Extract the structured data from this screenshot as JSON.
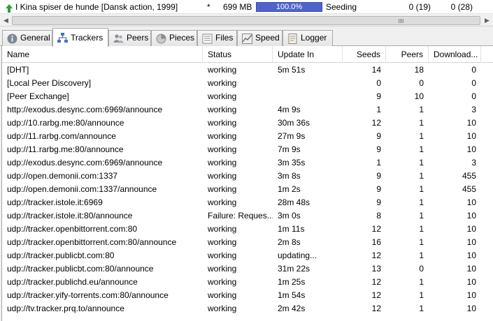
{
  "torrent": {
    "name": "I Kina spiser de hunde [Dansk action, 1999]",
    "star": "*",
    "size": "699 MB",
    "progress_label": "100.0%",
    "progress": 1.0,
    "status": "Seeding",
    "seeds": "0 (19)",
    "peers": "0 (28)"
  },
  "scrollbar": {
    "left_icon": "arrow-left-icon",
    "right_icon": "arrow-right-icon"
  },
  "tabs": [
    {
      "label": "General",
      "icon": "info-icon"
    },
    {
      "label": "Trackers",
      "icon": "network-icon",
      "active": true
    },
    {
      "label": "Peers",
      "icon": "people-icon"
    },
    {
      "label": "Pieces",
      "icon": "pie-icon"
    },
    {
      "label": "Files",
      "icon": "file-list-icon"
    },
    {
      "label": "Speed",
      "icon": "graph-icon"
    },
    {
      "label": "Logger",
      "icon": "log-icon"
    }
  ],
  "columns": {
    "name": "Name",
    "status": "Status",
    "update_in": "Update In",
    "seeds": "Seeds",
    "peers": "Peers",
    "downloaded": "Download..."
  },
  "rows": [
    {
      "name": "[DHT]",
      "status": "working",
      "update": "5m 51s",
      "seeds": "14",
      "peers": "18",
      "downloaded": "0"
    },
    {
      "name": "[Local Peer Discovery]",
      "status": "working",
      "update": "",
      "seeds": "0",
      "peers": "0",
      "downloaded": "0"
    },
    {
      "name": "[Peer Exchange]",
      "status": "working",
      "update": "",
      "seeds": "9",
      "peers": "10",
      "downloaded": "0"
    },
    {
      "name": "http://exodus.desync.com:6969/announce",
      "status": "working",
      "update": "4m 9s",
      "seeds": "1",
      "peers": "1",
      "downloaded": "3"
    },
    {
      "name": "udp://10.rarbg.me:80/announce",
      "status": "working",
      "update": "30m 36s",
      "seeds": "12",
      "peers": "1",
      "downloaded": "10"
    },
    {
      "name": "udp://11.rarbg.com/announce",
      "status": "working",
      "update": "27m 9s",
      "seeds": "9",
      "peers": "1",
      "downloaded": "10"
    },
    {
      "name": "udp://11.rarbg.me:80/announce",
      "status": "working",
      "update": "7m 9s",
      "seeds": "9",
      "peers": "1",
      "downloaded": "10"
    },
    {
      "name": "udp://exodus.desync.com:6969/announce",
      "status": "working",
      "update": "3m 35s",
      "seeds": "1",
      "peers": "1",
      "downloaded": "3"
    },
    {
      "name": "udp://open.demonii.com:1337",
      "status": "working",
      "update": "3m 8s",
      "seeds": "9",
      "peers": "1",
      "downloaded": "455"
    },
    {
      "name": "udp://open.demonii.com:1337/announce",
      "status": "working",
      "update": "1m 2s",
      "seeds": "9",
      "peers": "1",
      "downloaded": "455"
    },
    {
      "name": "udp://tracker.istole.it:6969",
      "status": "working",
      "update": "28m 48s",
      "seeds": "9",
      "peers": "1",
      "downloaded": "10"
    },
    {
      "name": "udp://tracker.istole.it:80/announce",
      "status": "Failure: Reques...",
      "update": "3m 0s",
      "seeds": "8",
      "peers": "1",
      "downloaded": "10"
    },
    {
      "name": "udp://tracker.openbittorrent.com:80",
      "status": "working",
      "update": "1m 11s",
      "seeds": "12",
      "peers": "1",
      "downloaded": "10"
    },
    {
      "name": "udp://tracker.openbittorrent.com:80/announce",
      "status": "working",
      "update": "2m 8s",
      "seeds": "16",
      "peers": "1",
      "downloaded": "10"
    },
    {
      "name": "udp://tracker.publicbt.com:80",
      "status": "working",
      "update": "updating...",
      "seeds": "12",
      "peers": "1",
      "downloaded": "10"
    },
    {
      "name": "udp://tracker.publicbt.com:80/announce",
      "status": "working",
      "update": "31m 22s",
      "seeds": "13",
      "peers": "0",
      "downloaded": "10"
    },
    {
      "name": "udp://tracker.publichd.eu/announce",
      "status": "working",
      "update": "1m 25s",
      "seeds": "12",
      "peers": "1",
      "downloaded": "10"
    },
    {
      "name": "udp://tracker.yify-torrents.com:80/announce",
      "status": "working",
      "update": "1m 54s",
      "seeds": "12",
      "peers": "1",
      "downloaded": "10"
    },
    {
      "name": "udp://tv.tracker.prq.to/announce",
      "status": "working",
      "update": "2m 42s",
      "seeds": "12",
      "peers": "1",
      "downloaded": "10"
    }
  ]
}
